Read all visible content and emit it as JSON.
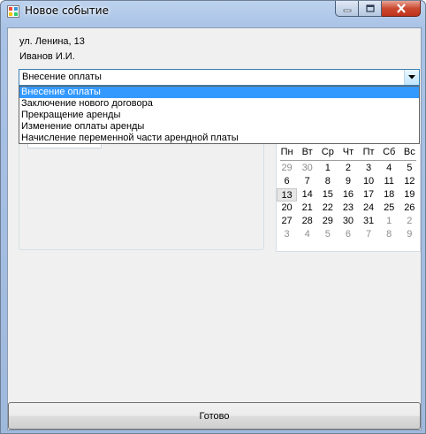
{
  "window": {
    "title": "Новое событие",
    "icon": "app-window-icon",
    "controls": [
      "minimize-icon",
      "maximize-icon",
      "close-icon"
    ]
  },
  "info": {
    "address": "ул. Ленина, 13",
    "person": "Иванов И.И."
  },
  "event_type": {
    "selected": "Внесение оплаты",
    "options": [
      "Внесение оплаты",
      "Заключение нового договора",
      "Прекращение аренды",
      "Изменение оплаты аренды",
      "Начисление переменной части арендной платы"
    ],
    "highlighted_index": 0,
    "highlight_color": "#3399ff"
  },
  "calendar": {
    "weekdays": [
      "Пн",
      "Вт",
      "Ср",
      "Чт",
      "Пт",
      "Сб",
      "Вс"
    ],
    "weeks": [
      [
        {
          "d": "29",
          "o": true
        },
        {
          "d": "30",
          "o": true
        },
        {
          "d": "1"
        },
        {
          "d": "2"
        },
        {
          "d": "3"
        },
        {
          "d": "4"
        },
        {
          "d": "5"
        }
      ],
      [
        {
          "d": "6"
        },
        {
          "d": "7"
        },
        {
          "d": "8"
        },
        {
          "d": "9"
        },
        {
          "d": "10"
        },
        {
          "d": "11"
        },
        {
          "d": "12"
        }
      ],
      [
        {
          "d": "13",
          "t": true
        },
        {
          "d": "14"
        },
        {
          "d": "15"
        },
        {
          "d": "16"
        },
        {
          "d": "17"
        },
        {
          "d": "18"
        },
        {
          "d": "19"
        }
      ],
      [
        {
          "d": "20"
        },
        {
          "d": "21"
        },
        {
          "d": "22"
        },
        {
          "d": "23"
        },
        {
          "d": "24"
        },
        {
          "d": "25"
        },
        {
          "d": "26"
        }
      ],
      [
        {
          "d": "27"
        },
        {
          "d": "28"
        },
        {
          "d": "29"
        },
        {
          "d": "30"
        },
        {
          "d": "31"
        },
        {
          "d": "1",
          "o": true
        },
        {
          "d": "2",
          "o": true
        }
      ],
      [
        {
          "d": "3",
          "o": true
        },
        {
          "d": "4",
          "o": true
        },
        {
          "d": "5",
          "o": true
        },
        {
          "d": "6",
          "o": true
        },
        {
          "d": "7",
          "o": true
        },
        {
          "d": "8",
          "o": true
        },
        {
          "d": "9",
          "o": true
        }
      ]
    ]
  },
  "footer": {
    "done_label": "Готово"
  }
}
